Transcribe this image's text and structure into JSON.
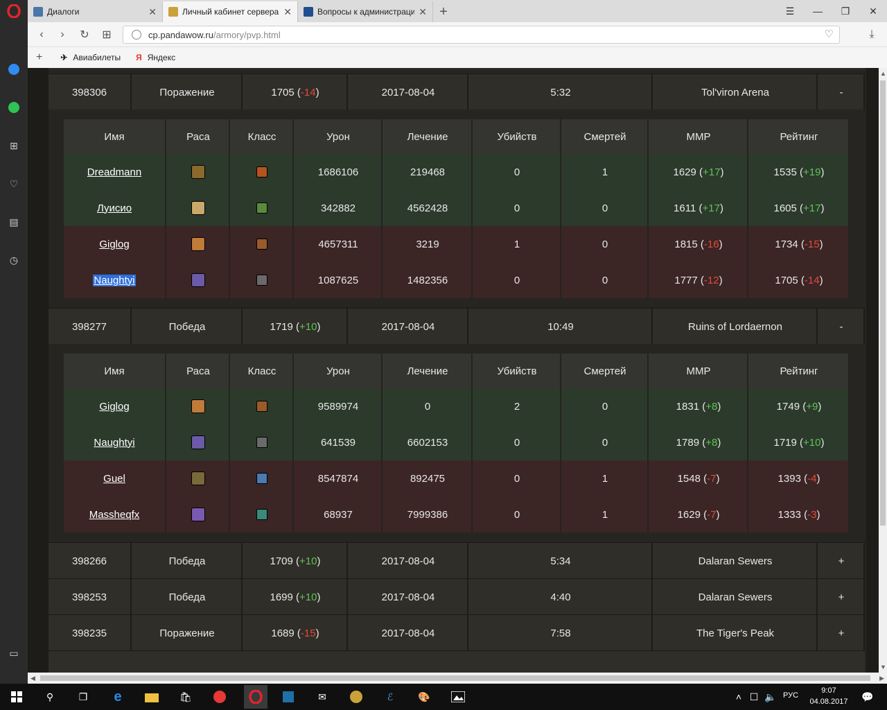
{
  "browser": {
    "tabs": [
      {
        "title": "Диалоги",
        "favicon_color": "#4a76a8",
        "active": false
      },
      {
        "title": "Личный кабинет сервера",
        "favicon_color": "#c9a23a",
        "active": true
      },
      {
        "title": "Вопросы к администрации",
        "favicon_color": "#1f4f8f",
        "active": false
      }
    ],
    "url_host": "cp.pandawow.ru",
    "url_path": "/armory/pvp.html",
    "bookmarks": [
      {
        "label": "Авиабилеты",
        "icon": "plane-icon"
      },
      {
        "label": "Яндекс",
        "icon": "yandex-icon"
      }
    ]
  },
  "colors": {
    "positive": "#5fc455",
    "negative": "#e24b3b",
    "win_row": "#2c3a2c",
    "loss_row": "#3c2525",
    "selection": "#2f6ed8"
  },
  "player_headers": [
    "Имя",
    "Раса",
    "Класс",
    "Урон",
    "Лечение",
    "Убийств",
    "Смертей",
    "MMP",
    "Рейтинг"
  ],
  "matches": [
    {
      "id": "398306",
      "result": "Поражение",
      "rating": "1705",
      "change": "-14",
      "change_sign": "neg",
      "date": "2017-08-04",
      "duration": "5:32",
      "arena": "Tol'viron Arena",
      "toggle": "-",
      "players": [
        {
          "name": "Dreadmann",
          "race": "orc-icon",
          "race_color": "#8a6a2c",
          "class": "warrior-icon",
          "class_color": "#b5541f",
          "damage": "1686106",
          "healing": "219468",
          "kills": "0",
          "deaths": "1",
          "mmr": "1629",
          "mmr_delta": "+17",
          "mmr_sign": "pos",
          "rating": "1535",
          "rating_delta": "+19",
          "rating_sign": "pos",
          "team": "win"
        },
        {
          "name": "Луисио",
          "race": "bloodelf-icon",
          "race_color": "#c9a86a",
          "class": "druid-icon",
          "class_color": "#5a8a3c",
          "damage": "342882",
          "healing": "4562428",
          "kills": "0",
          "deaths": "0",
          "mmr": "1611",
          "mmr_delta": "+17",
          "mmr_sign": "pos",
          "rating": "1605",
          "rating_delta": "+17",
          "rating_sign": "pos",
          "team": "win"
        },
        {
          "name": "Giglog",
          "race": "human-icon",
          "race_color": "#c07a3a",
          "class": "rogue-icon",
          "class_color": "#9a5a2a",
          "damage": "4657311",
          "healing": "3219",
          "kills": "1",
          "deaths": "0",
          "mmr": "1815",
          "mmr_delta": "-16",
          "mmr_sign": "neg",
          "rating": "1734",
          "rating_delta": "-15",
          "rating_sign": "neg",
          "team": "loss",
          "selected": false
        },
        {
          "name": "Naughtyi",
          "race": "nightelf-icon",
          "race_color": "#6a5aa8",
          "class": "priest-icon",
          "class_color": "#6a6a6a",
          "damage": "1087625",
          "healing": "1482356",
          "kills": "0",
          "deaths": "0",
          "mmr": "1777",
          "mmr_delta": "-12",
          "mmr_sign": "neg",
          "rating": "1705",
          "rating_delta": "-14",
          "rating_sign": "neg",
          "team": "loss",
          "selected": true
        }
      ]
    },
    {
      "id": "398277",
      "result": "Победа",
      "rating": "1719",
      "change": "+10",
      "change_sign": "pos",
      "date": "2017-08-04",
      "duration": "10:49",
      "arena": "Ruins of Lordaernon",
      "toggle": "-",
      "players": [
        {
          "name": "Giglog",
          "race": "human-icon",
          "race_color": "#c07a3a",
          "class": "rogue-icon",
          "class_color": "#9a5a2a",
          "damage": "9589974",
          "healing": "0",
          "kills": "2",
          "deaths": "0",
          "mmr": "1831",
          "mmr_delta": "+8",
          "mmr_sign": "pos",
          "rating": "1749",
          "rating_delta": "+9",
          "rating_sign": "pos",
          "team": "win"
        },
        {
          "name": "Naughtyi",
          "race": "nightelf-icon",
          "race_color": "#6a5aa8",
          "class": "priest-icon",
          "class_color": "#6a6a6a",
          "damage": "641539",
          "healing": "6602153",
          "kills": "0",
          "deaths": "0",
          "mmr": "1789",
          "mmr_delta": "+8",
          "mmr_sign": "pos",
          "rating": "1719",
          "rating_delta": "+10",
          "rating_sign": "pos",
          "team": "win"
        },
        {
          "name": "Guel",
          "race": "orc-icon",
          "race_color": "#7a6a3a",
          "class": "mage-icon",
          "class_color": "#4a7ab0",
          "damage": "8547874",
          "healing": "892475",
          "kills": "0",
          "deaths": "1",
          "mmr": "1548",
          "mmr_delta": "-7",
          "mmr_sign": "neg",
          "rating": "1393",
          "rating_delta": "-4",
          "rating_sign": "neg",
          "team": "loss"
        },
        {
          "name": "Massheqfx",
          "race": "nightelf-icon",
          "race_color": "#7a5ab0",
          "class": "shaman-icon",
          "class_color": "#3a8a7a",
          "damage": "68937",
          "healing": "7999386",
          "kills": "0",
          "deaths": "1",
          "mmr": "1629",
          "mmr_delta": "-7",
          "mmr_sign": "neg",
          "rating": "1333",
          "rating_delta": "-3",
          "rating_sign": "neg",
          "team": "loss"
        }
      ]
    },
    {
      "id": "398266",
      "result": "Победа",
      "rating": "1709",
      "change": "+10",
      "change_sign": "pos",
      "date": "2017-08-04",
      "duration": "5:34",
      "arena": "Dalaran Sewers",
      "toggle": "+"
    },
    {
      "id": "398253",
      "result": "Победа",
      "rating": "1699",
      "change": "+10",
      "change_sign": "pos",
      "date": "2017-08-04",
      "duration": "4:40",
      "arena": "Dalaran Sewers",
      "toggle": "+"
    },
    {
      "id": "398235",
      "result": "Поражение",
      "rating": "1689",
      "change": "-15",
      "change_sign": "neg",
      "date": "2017-08-04",
      "duration": "7:58",
      "arena": "The Tiger's Peak",
      "toggle": "+"
    }
  ],
  "taskbar": {
    "language": "РУС",
    "time": "9:07",
    "date": "04.08.2017"
  }
}
